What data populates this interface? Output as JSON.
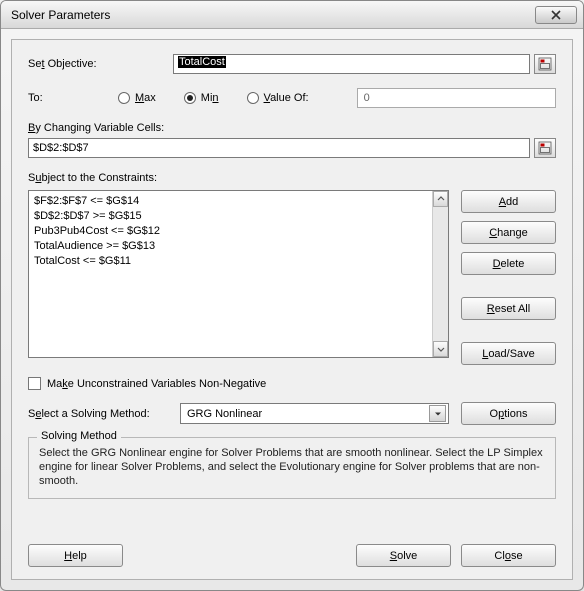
{
  "window": {
    "title": "Solver Parameters"
  },
  "objective": {
    "label_pre": "Se",
    "label_ul": "t",
    "label_post": " Objective:",
    "value": "TotalCost"
  },
  "to": {
    "label": "To:",
    "max_ul": "M",
    "max_post": "ax",
    "min_pre": "Mi",
    "min_ul": "n",
    "valueof_ul": "V",
    "valueof_post": "alue Of:",
    "value_input": "0",
    "selected": "min"
  },
  "changing": {
    "label_ul": "B",
    "label_post": "y Changing Variable Cells:",
    "value": "$D$2:$D$7"
  },
  "constraints": {
    "label_pre": "S",
    "label_ul": "u",
    "label_post": "bject to the Constraints:",
    "items": [
      "$F$2:$F$7 <= $G$14",
      "$D$2:$D$7 >= $G$15",
      "Pub3Pub4Cost <= $G$12",
      "TotalAudience >= $G$13",
      "TotalCost <= $G$11"
    ]
  },
  "buttons": {
    "add_ul": "A",
    "add_post": "dd",
    "change_ul": "C",
    "change_post": "hange",
    "delete_ul": "D",
    "delete_post": "elete",
    "reset_ul": "R",
    "reset_post": "eset All",
    "load_ul": "L",
    "load_post": "oad/Save",
    "options_pre": "O",
    "options_ul": "p",
    "options_post": "tions",
    "help_ul": "H",
    "help_post": "elp",
    "solve_ul": "S",
    "solve_post": "olve",
    "close_pre": "Cl",
    "close_ul": "o",
    "close_post": "se"
  },
  "checkbox": {
    "pre": "Ma",
    "ul": "k",
    "post": "e Unconstrained Variables Non-Negative",
    "checked": false
  },
  "method": {
    "label_pre": "S",
    "label_ul": "e",
    "label_post": "lect a Solving Method:",
    "selected": "GRG Nonlinear"
  },
  "group": {
    "legend": "Solving Method",
    "text": "Select the GRG Nonlinear engine for Solver Problems that are smooth nonlinear. Select the LP Simplex engine for linear Solver Problems, and select the Evolutionary engine for Solver problems that are non-smooth."
  }
}
